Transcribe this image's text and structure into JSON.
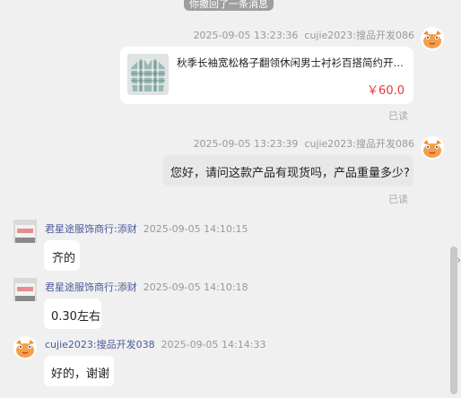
{
  "top_notice": "你撤回了一条消息",
  "messages": [
    {
      "timestamp": "2025-09-05 13:23:36",
      "sender": "cujie2023:搜品开发086",
      "product": {
        "title": "秋季长袖宽松格子翻领休闲男士衬衫百搭简约开衫...",
        "price": "￥60.0"
      },
      "status": "已读"
    },
    {
      "timestamp": "2025-09-05 13:23:39",
      "sender": "cujie2023:搜品开发086",
      "text": "您好，请问这款产品有现货吗，产品重量多少?",
      "status": "已读"
    },
    {
      "sender": "君星途服饰商行:添财",
      "timestamp": "2025-09-05 14:10:15",
      "text": "齐的"
    },
    {
      "sender": "君星途服饰商行:添财",
      "timestamp": "2025-09-05 14:10:18",
      "text": "0.30左右"
    },
    {
      "sender": "cujie2023:搜品开发038",
      "timestamp": "2025-09-05 14:14:33",
      "text": "好的，谢谢"
    }
  ],
  "side_arrow": "›",
  "colors": {
    "price": "#e53935",
    "buyer_avatar": "#f4a04a",
    "seller_name": "#4a5a9a"
  },
  "icons": {
    "buyer_avatar": "cartoon-avatar-icon",
    "seller_avatar": "shop-avatar-icon",
    "product": "plaid-shirt-thumbnail"
  }
}
